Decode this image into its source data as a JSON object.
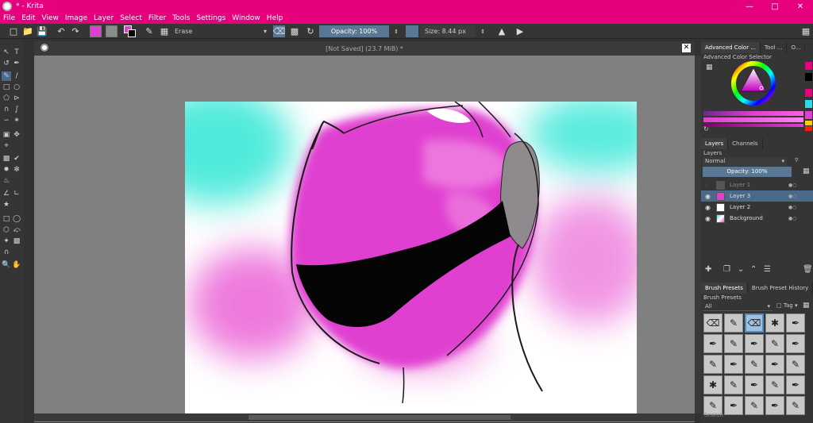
{
  "window": {
    "title": "* - Krita",
    "controls": [
      "minimize",
      "maximize",
      "close"
    ],
    "accent": "#e6007e"
  },
  "menu": [
    "File",
    "Edit",
    "View",
    "Image",
    "Layer",
    "Select",
    "Filter",
    "Tools",
    "Settings",
    "Window",
    "Help"
  ],
  "toolbar": {
    "blend_mode": "Erase",
    "opacity_label": "Opacity:  100%",
    "size_label": "Size:  8.44 px",
    "fg_color": "#e040d0",
    "bg_color": "#9a9a9a"
  },
  "document": {
    "tab_label": "[Not Saved]  (23.7 MiB) *"
  },
  "panels": {
    "color_tabs": [
      "Advanced Color ...",
      "Tool ...",
      "O..."
    ],
    "color_selector_title": "Advanced Color Selector",
    "layers_tabs": [
      "Layers",
      "Channels"
    ],
    "layers_title": "Layers",
    "blend": "Normal",
    "opacity": "Opacity:  100%",
    "layers": [
      {
        "name": "Layer 1",
        "visible": false,
        "selected": false
      },
      {
        "name": "Layer 3",
        "visible": true,
        "selected": true
      },
      {
        "name": "Layer 2",
        "visible": true,
        "selected": false
      },
      {
        "name": "Background",
        "visible": true,
        "selected": false
      }
    ],
    "brush_tabs": [
      "Brush Presets",
      "Brush Preset History"
    ],
    "brush_title": "Brush Presets",
    "brush_filter": "All",
    "brush_tag": "Tag",
    "search_placeholder": "Search"
  }
}
